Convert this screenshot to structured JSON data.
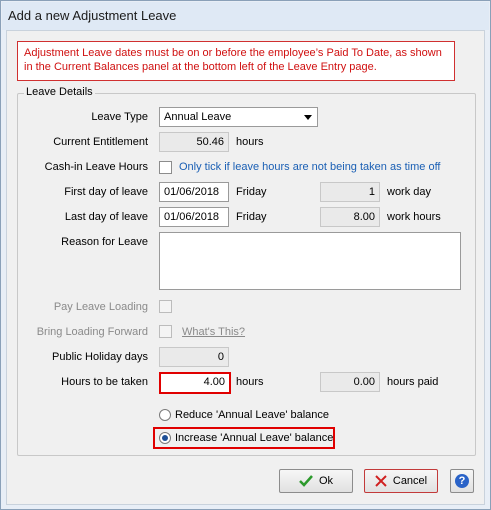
{
  "window": {
    "title": "Add a new Adjustment Leave"
  },
  "warning": {
    "line1": "Adjustment Leave dates must be on or before the employee’s Paid To Date, as shown",
    "line2": "in the Current Balances panel at the bottom left of the Leave Entry page."
  },
  "leave_details": {
    "group_title": "Leave Details",
    "leave_type": {
      "label": "Leave Type",
      "value": "Annual Leave"
    },
    "current_entitlement": {
      "label": "Current Entitlement",
      "value": "50.46",
      "unit": "hours"
    },
    "cash_in": {
      "label": "Cash-in Leave Hours",
      "note": "Only tick if leave hours are not being taken as time off"
    },
    "first_day": {
      "label": "First day of leave",
      "date": "01/06/2018",
      "weekday": "Friday",
      "count": "1",
      "unit": "work day"
    },
    "last_day": {
      "label": "Last day of leave",
      "date": "01/06/2018",
      "weekday": "Friday",
      "hours": "8.00",
      "unit": "work hours"
    },
    "reason": {
      "label": "Reason for Leave",
      "value": ""
    },
    "pay_leave_loading": {
      "label": "Pay Leave Loading"
    },
    "bring_loading_forward": {
      "label": "Bring Loading Forward",
      "link": "What's This?"
    },
    "public_holiday_days": {
      "label": "Public Holiday days",
      "value": "0"
    },
    "hours_to_be_taken": {
      "label": "Hours to be taken",
      "value": "4.00",
      "unit": "hours",
      "paid_value": "0.00",
      "paid_unit": "hours paid"
    },
    "options": {
      "reduce": "Reduce 'Annual Leave' balance",
      "increase": "Increase 'Annual Leave' balance",
      "selected": "increase"
    }
  },
  "buttons": {
    "ok": "Ok",
    "cancel": "Cancel"
  },
  "colors": {
    "highlight": "#e00000",
    "warning_text": "#d01010",
    "link": "#1a5fb4"
  },
  "icons": [
    "checkmark-icon",
    "cross-icon",
    "help-icon",
    "dropdown-arrow-icon"
  ]
}
